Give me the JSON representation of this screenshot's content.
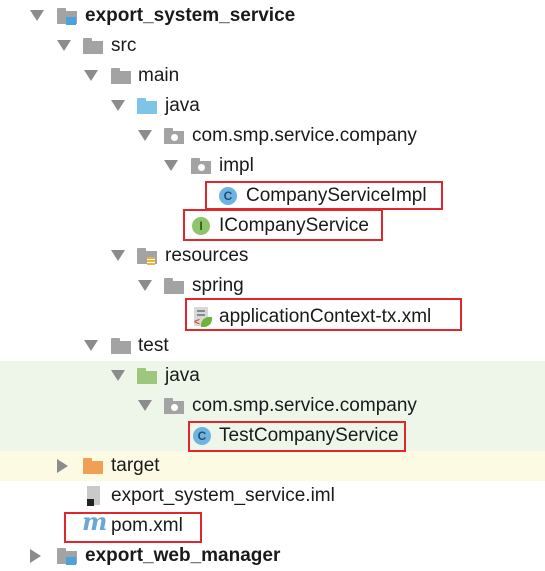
{
  "tree": {
    "root": {
      "label": "export_system_service"
    },
    "src": {
      "label": "src"
    },
    "main": {
      "label": "main"
    },
    "main_java": {
      "label": "java"
    },
    "main_pkg": {
      "label": "com.smp.service.company"
    },
    "impl": {
      "label": "impl"
    },
    "impl_class": {
      "label": "CompanyServiceImpl",
      "icon": "class-icon"
    },
    "interface": {
      "label": "ICompanyService",
      "icon": "interface-icon"
    },
    "resources": {
      "label": "resources"
    },
    "spring": {
      "label": "spring"
    },
    "spring_xml": {
      "label": "applicationContext-tx.xml",
      "icon": "spring-xml-icon"
    },
    "test": {
      "label": "test"
    },
    "test_java": {
      "label": "java"
    },
    "test_pkg": {
      "label": "com.smp.service.company"
    },
    "test_class": {
      "label": "TestCompanyService",
      "icon": "test-class-icon"
    },
    "target": {
      "label": "target"
    },
    "iml": {
      "label": "export_system_service.iml"
    },
    "pom": {
      "label": "pom.xml",
      "icon_glyph": "m"
    },
    "next_module": {
      "label": "export_web_manager"
    }
  },
  "colors": {
    "highlight": "#e0282c",
    "test_band": "#eef6ea",
    "target_band": "#fcfae2"
  }
}
